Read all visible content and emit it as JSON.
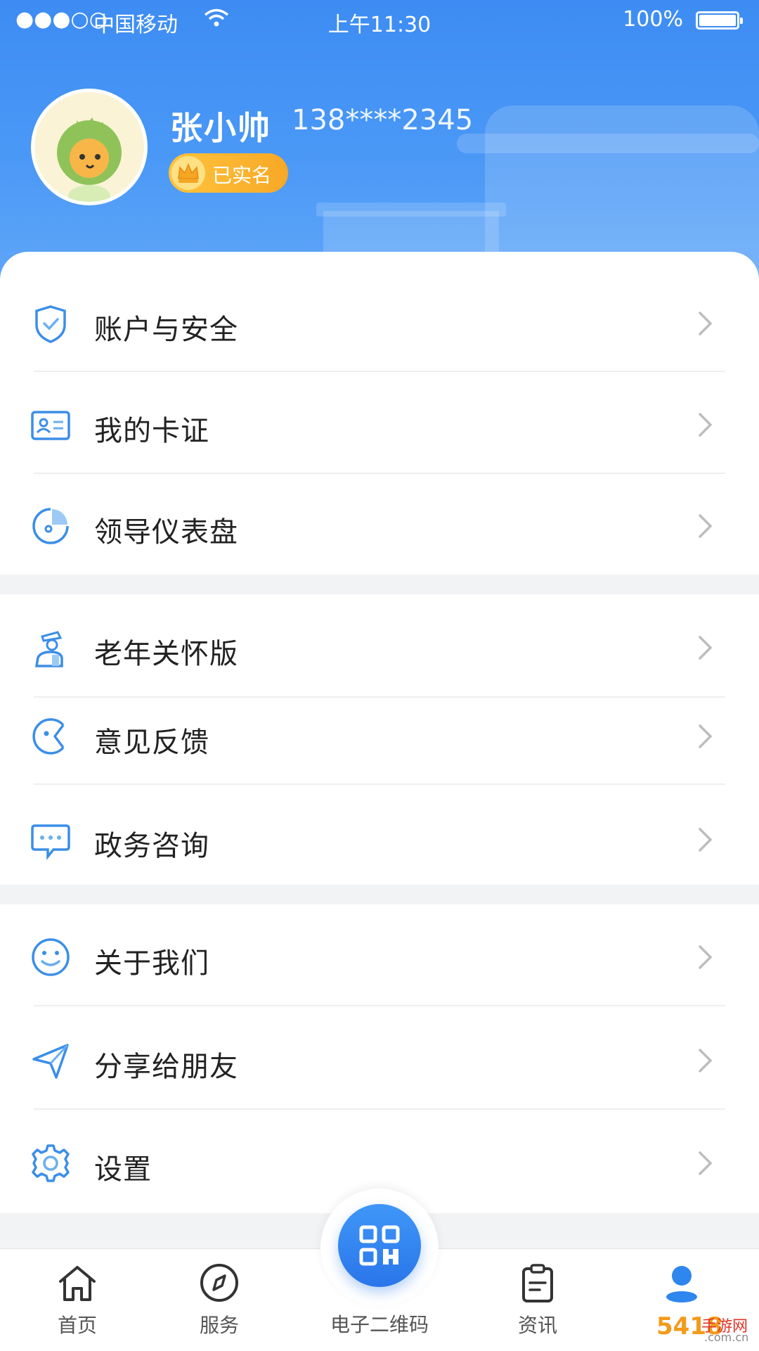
{
  "status_bar": {
    "carrier": "中国移动",
    "time": "上午11:30",
    "battery": "100%"
  },
  "profile": {
    "name": "张小帅",
    "phone": "138****2345",
    "badge": "已实名"
  },
  "menu_groups": [
    {
      "items": [
        {
          "label": "账户与安全",
          "icon": "shield-check-icon"
        },
        {
          "label": "我的卡证",
          "icon": "id-card-icon"
        },
        {
          "label": "领导仪表盘",
          "icon": "dashboard-pie-icon"
        }
      ]
    },
    {
      "items": [
        {
          "label": "老年关怀版",
          "icon": "elder-person-icon"
        },
        {
          "label": "意见反馈",
          "icon": "feedback-icon"
        },
        {
          "label": "政务咨询",
          "icon": "chat-bubble-icon"
        }
      ]
    },
    {
      "items": [
        {
          "label": "关于我们",
          "icon": "smile-icon"
        },
        {
          "label": "分享给朋友",
          "icon": "send-icon"
        },
        {
          "label": "设置",
          "icon": "gear-icon"
        }
      ]
    }
  ],
  "tabbar": {
    "home": "首页",
    "service": "服务",
    "qrcode": "电子二维码",
    "news": "资讯",
    "mine": "我的"
  },
  "watermark": {
    "brand": "5418",
    "site": "手游网",
    "domain": ".com.cn"
  },
  "colors": {
    "primary": "#3d8cf3",
    "icon": "#3b8ee8",
    "badge": "#f7a827"
  }
}
